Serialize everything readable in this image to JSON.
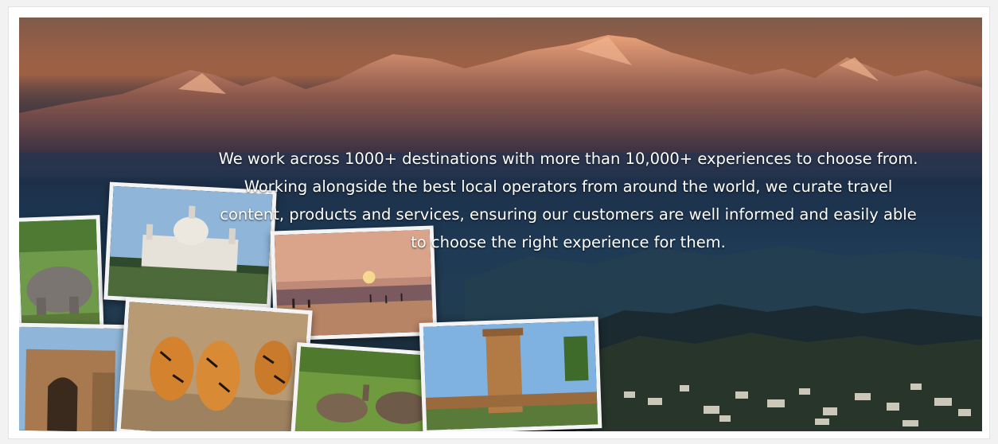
{
  "banner": {
    "tagline": "We work across 1000+ destinations with more than 10,000+  experiences to choose from. Working alongside the best local operators from around the world, we curate travel content, products and services, ensuring our customers are well informed and easily able to choose the right experience for them.",
    "photos": [
      "elephant-photo",
      "victoria-memorial-photo",
      "sunset-beach-photo",
      "ruined-gate-photo",
      "tigers-photo",
      "deer-photo",
      "stone-tower-photo"
    ]
  },
  "colors": {
    "sky_top": "#4a3a3a",
    "sunset_glow": "#c9734a",
    "night_blue": "#1e3a55",
    "text": "#ffffff",
    "photo_border": "#f4f4f4"
  }
}
